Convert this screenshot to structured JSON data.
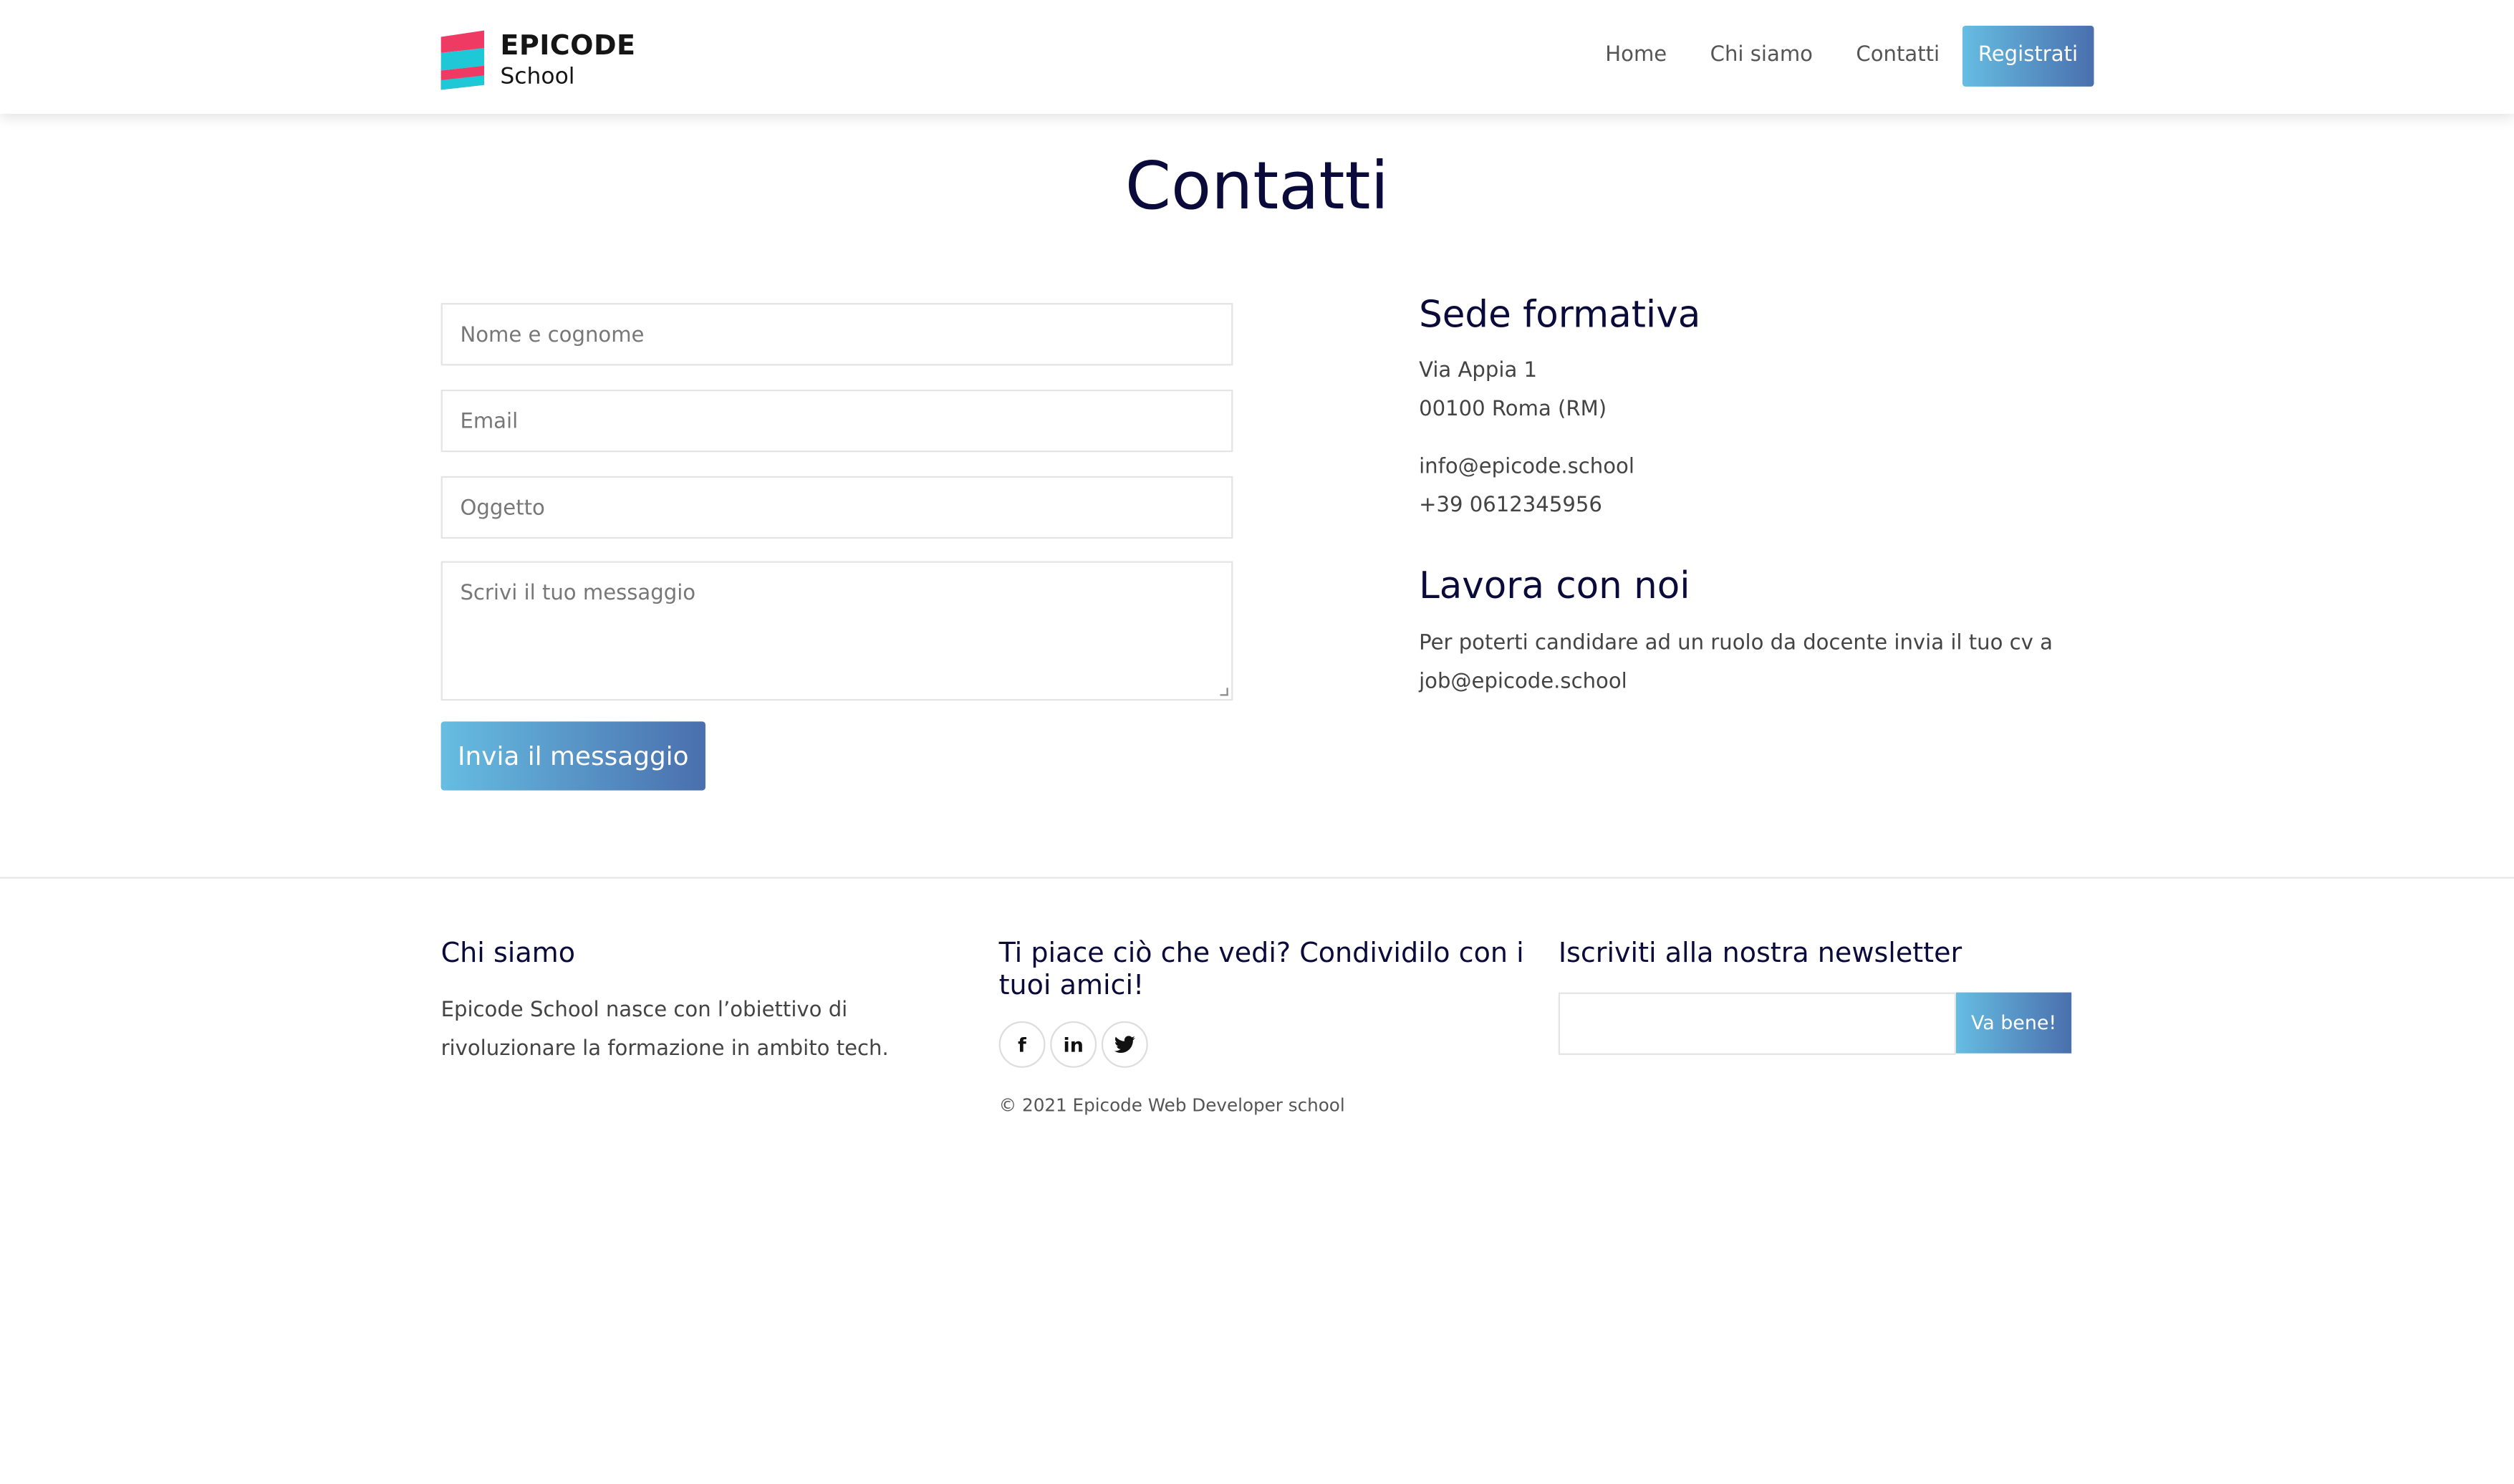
{
  "header": {
    "logo": {
      "top": "EPICODE",
      "bottom": "School"
    },
    "nav": {
      "home": "Home",
      "about": "Chi siamo",
      "contacts": "Contatti",
      "register": "Registrati"
    }
  },
  "page_title": "Contatti",
  "form": {
    "name_placeholder": "Nome e cognome",
    "email_placeholder": "Email",
    "subject_placeholder": "Oggetto",
    "message_placeholder": "Scrivi il tuo messaggio",
    "submit_label": "Invia il messaggio"
  },
  "info": {
    "sede_title": "Sede formativa",
    "address_line1": "Via Appia 1",
    "address_line2": "00100 Roma (RM)",
    "email": "info@epicode.school",
    "phone": "+39 0612345956",
    "work_title": "Lavora con noi",
    "work_text": "Per poterti candidare ad un ruolo da docente invia il tuo cv a job@epicode.school"
  },
  "footer": {
    "about_title": "Chi siamo",
    "about_text": "Epicode School nasce con l’obiettivo di rivoluzionare la formazione in ambito tech.",
    "share_title": "Ti piace ciò che vedi? Condividilo con i tuoi amici!",
    "social": {
      "facebook": "f",
      "linkedin": "in",
      "twitter": "twitter"
    },
    "copyright": "© 2021 Epicode Web Developer school",
    "newsletter_title": "Iscriviti alla nostra newsletter",
    "newsletter_button": "Va bene!"
  },
  "colors": {
    "accent_start": "#66bde2",
    "accent_end": "#4a6fad",
    "heading": "#0b0b3b"
  }
}
